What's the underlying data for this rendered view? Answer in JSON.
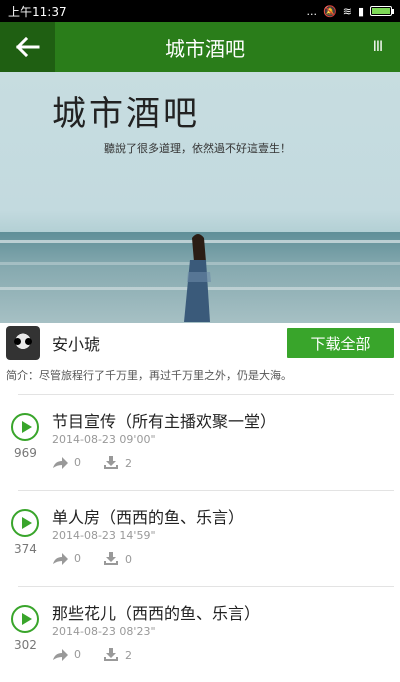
{
  "status_bar": {
    "time": "上午11:37",
    "dots": "...",
    "battery_level": 0.9
  },
  "app_bar": {
    "back_icon": "arrow-left-icon",
    "title": "城市酒吧",
    "menu_icon": "bars-icon",
    "menu_glyph": "III"
  },
  "banner": {
    "title": "城市酒吧",
    "subtitle": "聽說了很多道理，依然過不好這壹生！"
  },
  "author": {
    "name": "安小琥",
    "download_all_label": "下载全部"
  },
  "intro": "简介：尽管旅程行了千万里，再过千万里之外，仍是大海。",
  "episodes": [
    {
      "title": "节目宣传（所有主播欢聚一堂）",
      "date": "2014-08-23  09'00\"",
      "plays": "969",
      "shares": "0",
      "downloads": "2"
    },
    {
      "title": "单人房（西西的鱼、乐言）",
      "date": "2014-08-23  14'59\"",
      "plays": "374",
      "shares": "0",
      "downloads": "0"
    },
    {
      "title": "那些花儿（西西的鱼、乐言）",
      "date": "2014-08-23  08'23\"",
      "plays": "302",
      "shares": "0",
      "downloads": "2"
    }
  ],
  "colors": {
    "app_bar": "#2a7d1a",
    "accent": "#39a52b"
  }
}
